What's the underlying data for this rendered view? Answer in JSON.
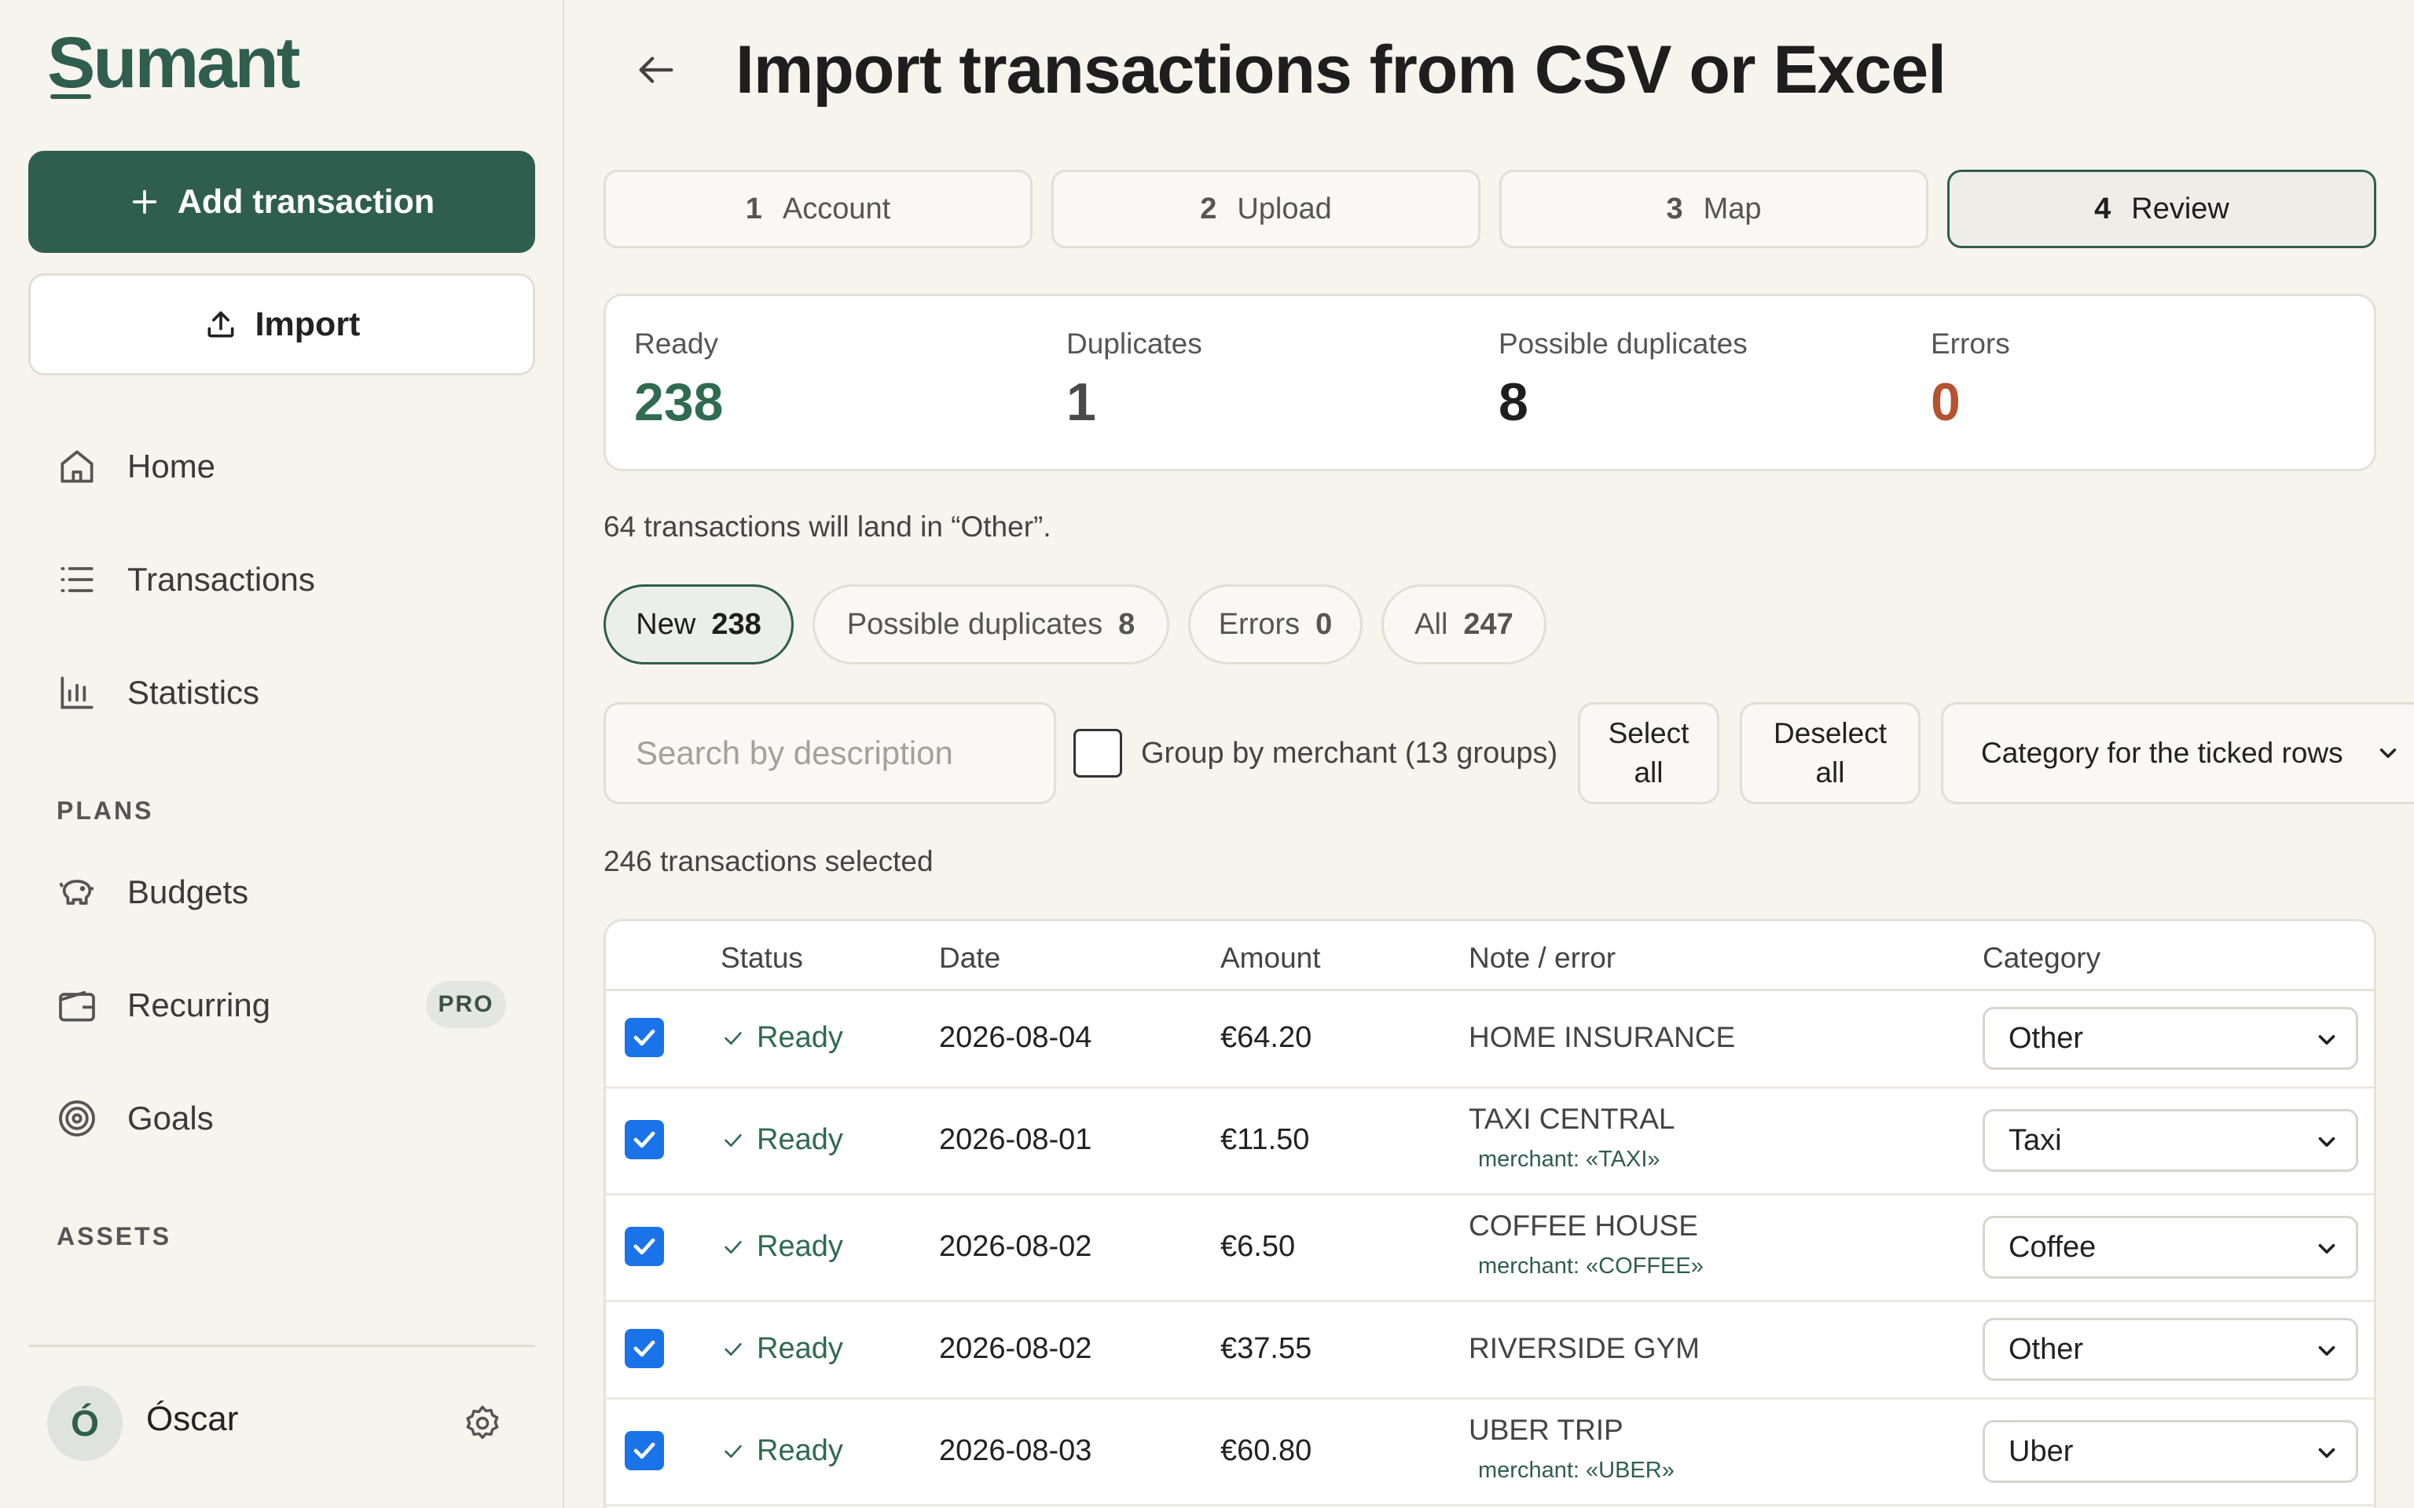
{
  "app": {
    "name": "Sumant"
  },
  "sidebar": {
    "add_label": "Add transaction",
    "import_label": "Import",
    "nav": [
      {
        "label": "Home",
        "icon": "home-icon"
      },
      {
        "label": "Transactions",
        "icon": "list-icon"
      },
      {
        "label": "Statistics",
        "icon": "chart-icon"
      }
    ],
    "plans_label": "PLANS",
    "plans": [
      {
        "label": "Budgets",
        "icon": "piggy-bank-icon"
      },
      {
        "label": "Recurring",
        "icon": "wallet-icon",
        "badge": "PRO"
      },
      {
        "label": "Goals",
        "icon": "target-icon"
      }
    ],
    "assets_label": "ASSETS",
    "user": {
      "initial": "Ó",
      "name": "Óscar"
    }
  },
  "page": {
    "title": "Import transactions from CSV or Excel"
  },
  "steps": [
    {
      "num": "1",
      "label": "Account"
    },
    {
      "num": "2",
      "label": "Upload"
    },
    {
      "num": "3",
      "label": "Map"
    },
    {
      "num": "4",
      "label": "Review",
      "active": true
    }
  ],
  "stats": {
    "ready": {
      "label": "Ready",
      "value": "238",
      "color": "#2f6b50"
    },
    "duplicates": {
      "label": "Duplicates",
      "value": "1",
      "color": "#4a4a4a"
    },
    "possible": {
      "label": "Possible duplicates",
      "value": "8",
      "color": "#1e1e1e"
    },
    "errors": {
      "label": "Errors",
      "value": "0",
      "color": "#b5522f"
    }
  },
  "notice": "64 transactions will land in “Other”.",
  "filters": [
    {
      "label": "New",
      "count": "238",
      "active": true
    },
    {
      "label": "Possible duplicates",
      "count": "8"
    },
    {
      "label": "Errors",
      "count": "0"
    },
    {
      "label": "All",
      "count": "247"
    }
  ],
  "toolbar": {
    "search_placeholder": "Search by description",
    "group_label": "Group by merchant (13 groups)",
    "select_all_1": "Select",
    "select_all_2": "all",
    "deselect_all_1": "Deselect",
    "deselect_all_2": "all",
    "category_label": "Category for the ticked rows"
  },
  "selected_count": "246 transactions selected",
  "table": {
    "headers": {
      "status": "Status",
      "date": "Date",
      "amount": "Amount",
      "note": "Note / error",
      "category": "Category"
    },
    "rows": [
      {
        "status": "Ready",
        "date": "2026-08-04",
        "amount": "€64.20",
        "note": "HOME INSURANCE",
        "merchant": "",
        "category": "Other"
      },
      {
        "status": "Ready",
        "date": "2026-08-01",
        "amount": "€11.50",
        "note": "TAXI CENTRAL",
        "merchant": "merchant: «TAXI»",
        "category": "Taxi"
      },
      {
        "status": "Ready",
        "date": "2026-08-02",
        "amount": "€6.50",
        "note": "COFFEE HOUSE",
        "merchant": "merchant: «COFFEE»",
        "category": "Coffee"
      },
      {
        "status": "Ready",
        "date": "2026-08-02",
        "amount": "€37.55",
        "note": "RIVERSIDE GYM",
        "merchant": "",
        "category": "Other"
      },
      {
        "status": "Ready",
        "date": "2026-08-03",
        "amount": "€60.80",
        "note": "UBER TRIP",
        "merchant": "merchant: «UBER»",
        "category": "Uber"
      }
    ]
  }
}
